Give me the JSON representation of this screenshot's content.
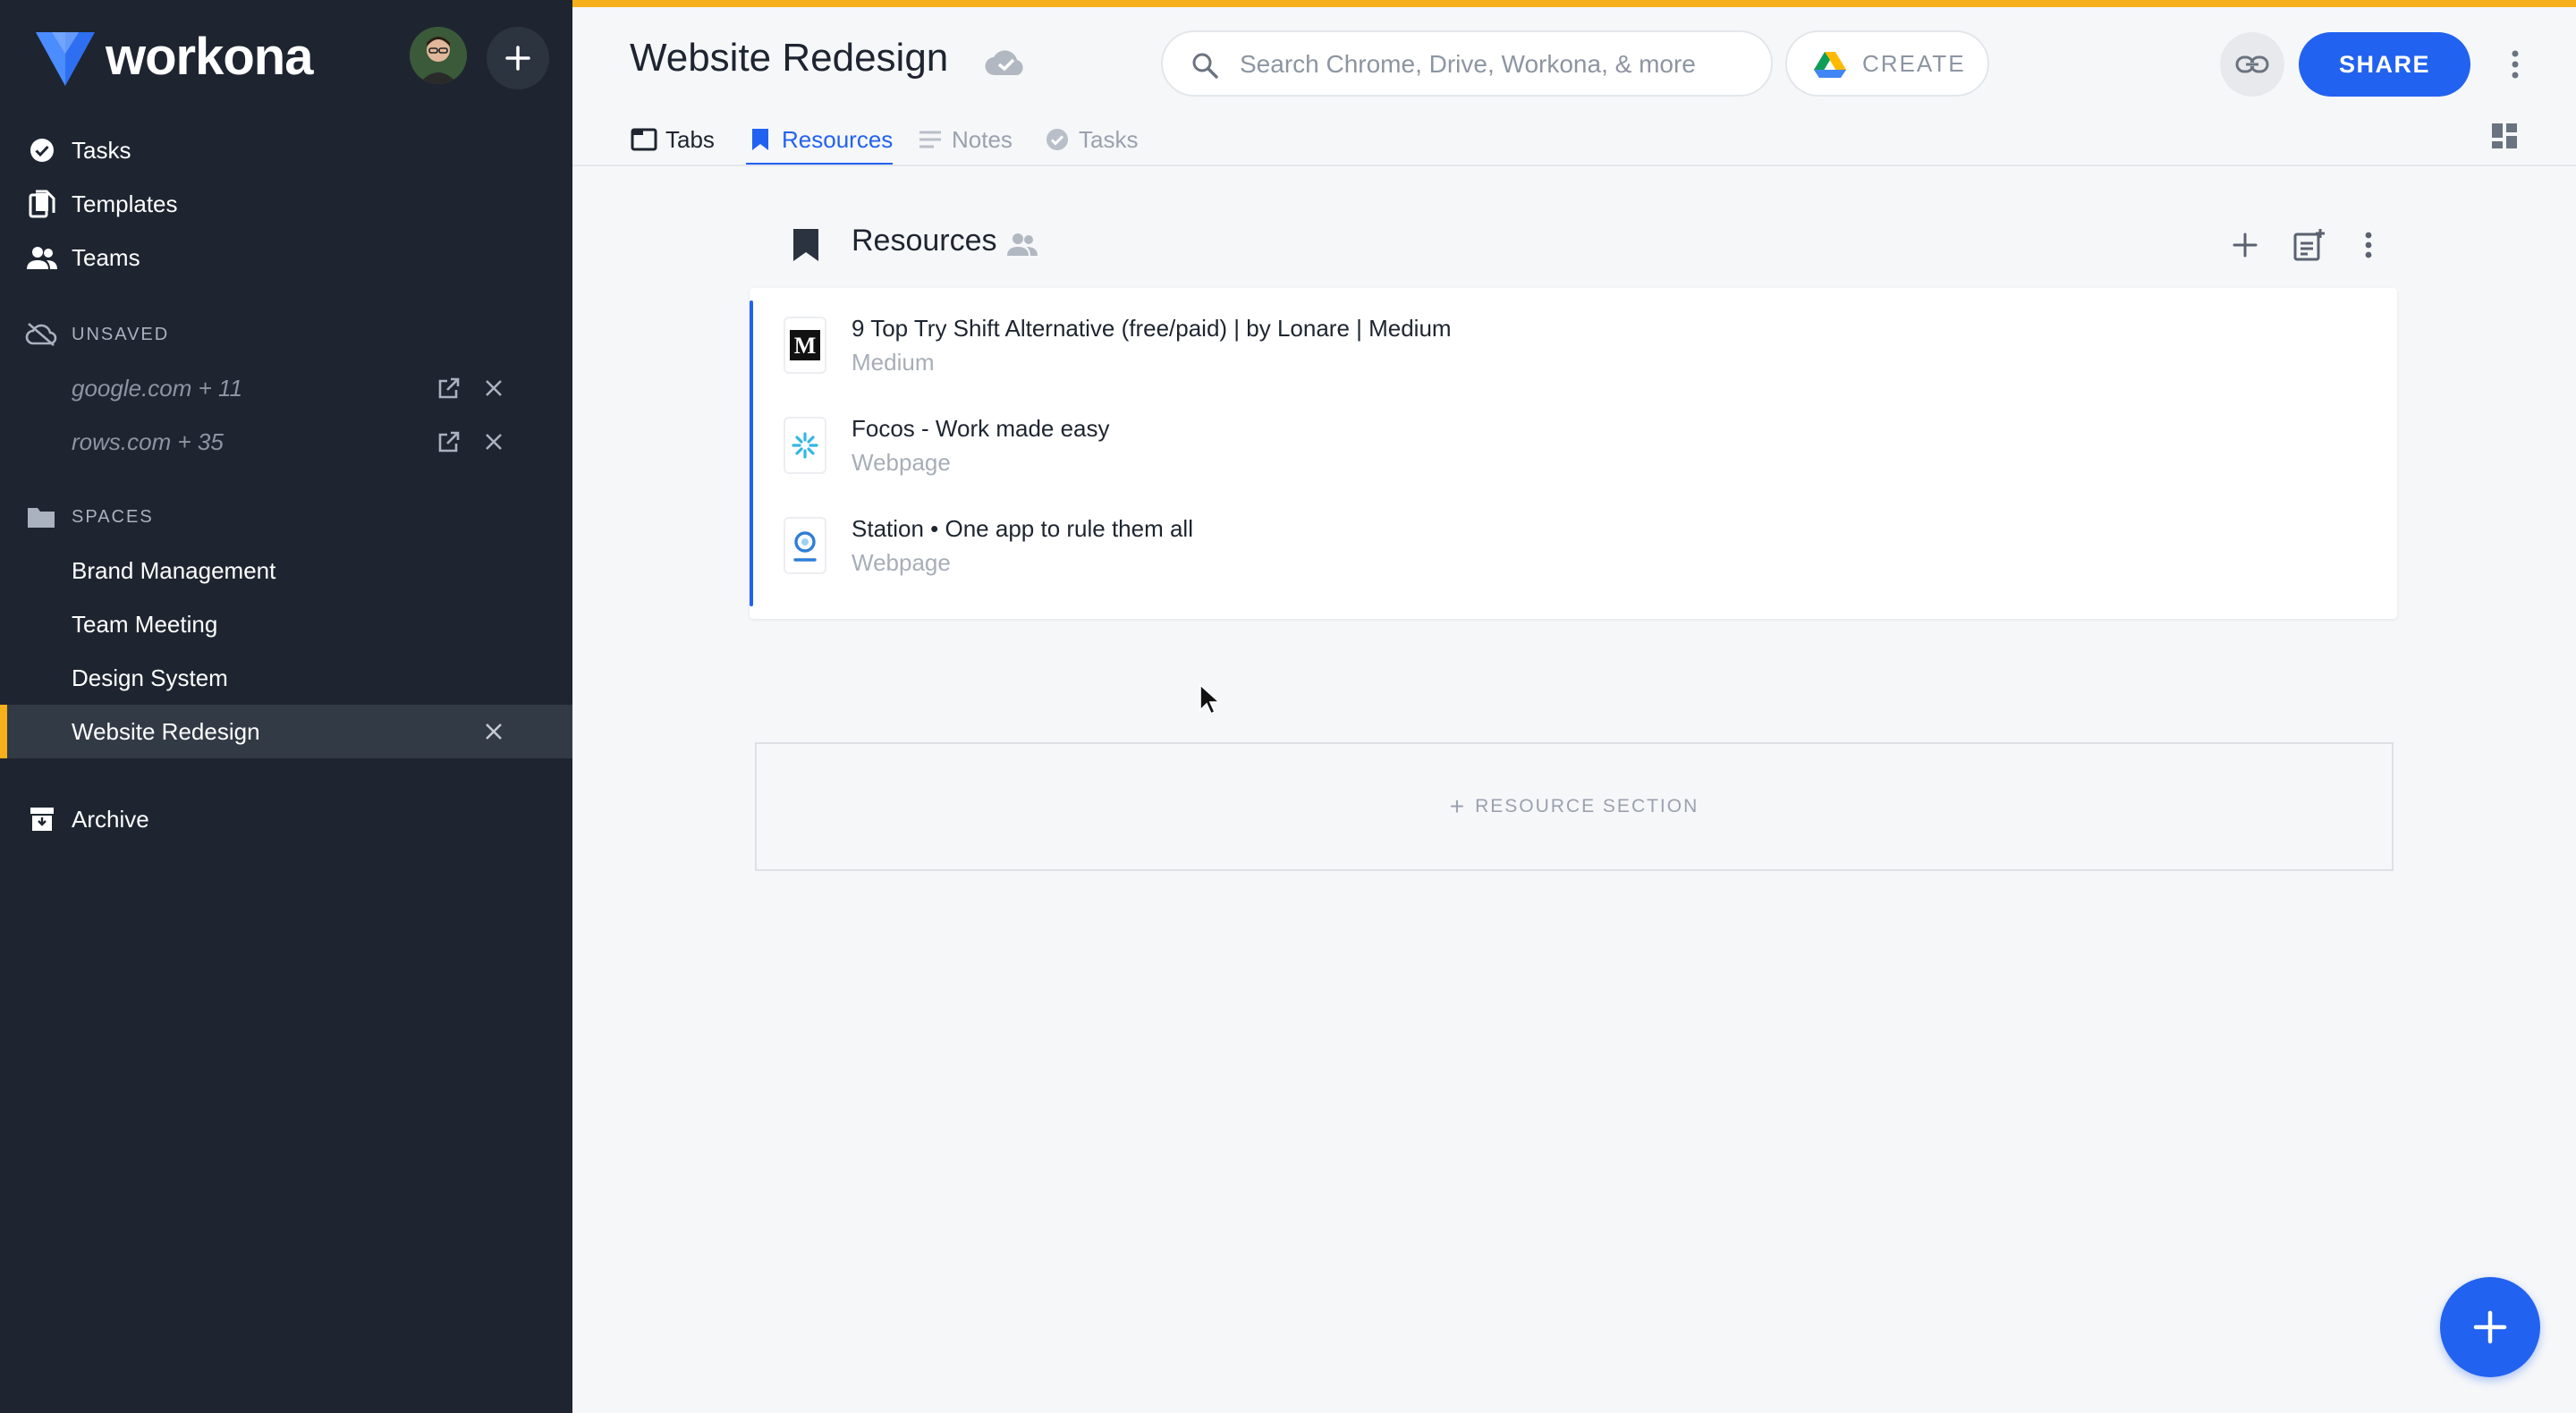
{
  "app": {
    "name": "workona"
  },
  "sidebar": {
    "nav": [
      {
        "label": "Tasks",
        "icon": "check-circle-icon"
      },
      {
        "label": "Templates",
        "icon": "templates-icon"
      },
      {
        "label": "Teams",
        "icon": "people-icon"
      }
    ],
    "unsaved": {
      "heading": "UNSAVED",
      "items": [
        {
          "label": "google.com + 11"
        },
        {
          "label": "rows.com + 35"
        }
      ]
    },
    "spaces": {
      "heading": "SPACES",
      "items": [
        {
          "label": "Brand Management"
        },
        {
          "label": "Team Meeting"
        },
        {
          "label": "Design System"
        },
        {
          "label": "Website Redesign",
          "active": true
        }
      ]
    },
    "archive": {
      "label": "Archive"
    }
  },
  "header": {
    "title": "Website Redesign",
    "search_placeholder": "Search Chrome, Drive, Workona, & more",
    "create_label": "CREATE",
    "share_label": "SHARE",
    "tabs": [
      {
        "label": "Tabs"
      },
      {
        "label": "Resources",
        "active": true
      },
      {
        "label": "Notes"
      },
      {
        "label": "Tasks"
      }
    ]
  },
  "resources": {
    "title": "Resources",
    "items": [
      {
        "title": "9 Top Try Shift Alternative (free/paid) | by Lonare | Medium",
        "subtitle": "Medium",
        "favicon": "medium-icon"
      },
      {
        "title": "Focos - Work made easy",
        "subtitle": "Webpage",
        "favicon": "focos-icon"
      },
      {
        "title": "Station • One app to rule them all",
        "subtitle": "Webpage",
        "favicon": "station-icon"
      }
    ],
    "add_section_label": "RESOURCE SECTION"
  },
  "colors": {
    "accent": "#2262f0",
    "sidebar_bg": "#1e2530",
    "top_stripe": "#f7b01b"
  }
}
